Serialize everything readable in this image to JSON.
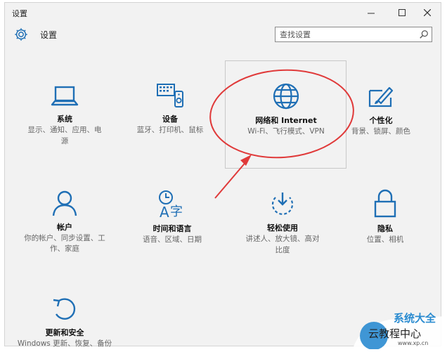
{
  "window": {
    "title": "设置"
  },
  "header": {
    "title": "设置",
    "search_placeholder": "查找设置"
  },
  "tiles": [
    {
      "label": "系统",
      "desc1": "显示、通知、应用、电",
      "desc2": "源"
    },
    {
      "label": "设备",
      "desc1": "蓝牙、打印机、鼠标",
      "desc2": ""
    },
    {
      "label": "网络和 Internet",
      "desc1": "Wi-Fi、飞行模式、VPN",
      "desc2": ""
    },
    {
      "label": "个性化",
      "desc1": "背景、锁屏、颜色",
      "desc2": ""
    },
    {
      "label": "帐户",
      "desc1": "你的帐户、同步设置、工作、家庭",
      "desc2": ""
    },
    {
      "label": "时间和语言",
      "desc1": "语音、区域、日期",
      "desc2": ""
    },
    {
      "label": "轻松使用",
      "desc1": "讲述人、放大镜、高对",
      "desc2": "比度"
    },
    {
      "label": "隐私",
      "desc1": "位置、相机",
      "desc2": ""
    },
    {
      "label": "更新和安全",
      "desc1": "Windows 更新、恢复、备份",
      "desc2": ""
    }
  ],
  "watermark": {
    "top": "系统大全",
    "main": "云教程中心",
    "url": "www.xp.cn"
  },
  "colors": {
    "icon": "#1f6fb5",
    "annotation": "#e03a3a",
    "window_bg": "#f2f2f2"
  }
}
